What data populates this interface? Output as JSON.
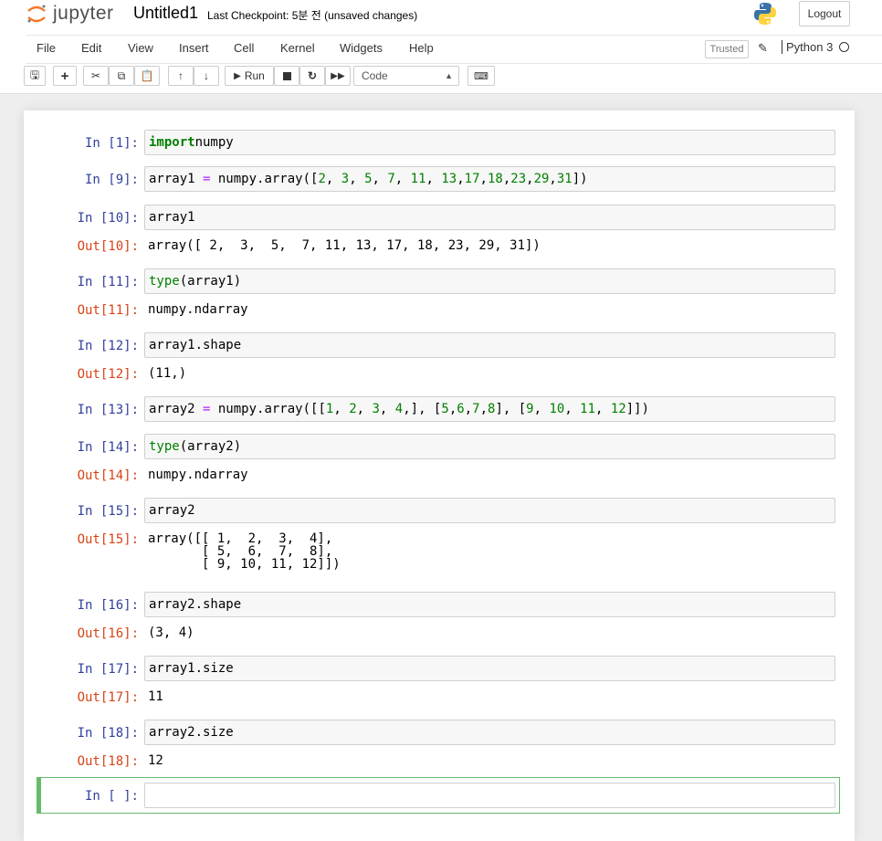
{
  "header": {
    "logo_text": "jupyter",
    "notebook_name": "Untitled1",
    "checkpoint": "Last Checkpoint: 5분 전  (unsaved changes)",
    "logout_label": "Logout"
  },
  "menu": {
    "items": [
      "File",
      "Edit",
      "View",
      "Insert",
      "Cell",
      "Kernel",
      "Widgets",
      "Help"
    ],
    "trusted_label": "Trusted",
    "kernel_name": "Python 3"
  },
  "toolbar": {
    "run_label": "Run",
    "cell_type": "Code"
  },
  "cells": [
    {
      "in": "In [1]:",
      "code": [
        [
          "kw",
          "import"
        ],
        [
          "",
          "numpy"
        ]
      ],
      "out": null,
      "out_text": null
    },
    {
      "in": "In [9]:",
      "code": [
        [
          "",
          "array1 "
        ],
        [
          "op",
          "="
        ],
        [
          "",
          " numpy.array(["
        ],
        [
          "num",
          "2"
        ],
        [
          "",
          ", "
        ],
        [
          "num",
          "3"
        ],
        [
          "",
          ", "
        ],
        [
          "num",
          "5"
        ],
        [
          "",
          ", "
        ],
        [
          "num",
          "7"
        ],
        [
          "",
          ", "
        ],
        [
          "num",
          "11"
        ],
        [
          "",
          ", "
        ],
        [
          "num",
          "13"
        ],
        [
          "",
          ","
        ],
        [
          "num",
          "17"
        ],
        [
          "",
          ","
        ],
        [
          "num",
          "18"
        ],
        [
          "",
          ","
        ],
        [
          "num",
          "23"
        ],
        [
          "",
          ","
        ],
        [
          "num",
          "29"
        ],
        [
          "",
          ","
        ],
        [
          "num",
          "31"
        ],
        [
          "",
          "])"
        ]
      ],
      "out": null,
      "out_text": null
    },
    {
      "in": "In [10]:",
      "code": [
        [
          "",
          "array1"
        ]
      ],
      "out": "Out[10]:",
      "out_text": "array([ 2,  3,  5,  7, 11, 13, 17, 18, 23, 29, 31])"
    },
    {
      "in": "In [11]:",
      "code": [
        [
          "bi",
          "type"
        ],
        [
          "",
          "(array1)"
        ]
      ],
      "out": "Out[11]:",
      "out_text": "numpy.ndarray"
    },
    {
      "in": "In [12]:",
      "code": [
        [
          "",
          "array1.shape"
        ]
      ],
      "out": "Out[12]:",
      "out_text": "(11,)"
    },
    {
      "in": "In [13]:",
      "code": [
        [
          "",
          "array2 "
        ],
        [
          "op",
          "="
        ],
        [
          "",
          " numpy.array([["
        ],
        [
          "num",
          "1"
        ],
        [
          "",
          ", "
        ],
        [
          "num",
          "2"
        ],
        [
          "",
          ", "
        ],
        [
          "num",
          "3"
        ],
        [
          "",
          ", "
        ],
        [
          "num",
          "4"
        ],
        [
          "",
          ",], ["
        ],
        [
          "num",
          "5"
        ],
        [
          "",
          ","
        ],
        [
          "num",
          "6"
        ],
        [
          "",
          ","
        ],
        [
          "num",
          "7"
        ],
        [
          "",
          ","
        ],
        [
          "num",
          "8"
        ],
        [
          "",
          "], ["
        ],
        [
          "num",
          "9"
        ],
        [
          "",
          ", "
        ],
        [
          "num",
          "10"
        ],
        [
          "",
          ", "
        ],
        [
          "num",
          "11"
        ],
        [
          "",
          ", "
        ],
        [
          "num",
          "12"
        ],
        [
          "",
          "]])"
        ]
      ],
      "out": null,
      "out_text": null
    },
    {
      "in": "In [14]:",
      "code": [
        [
          "bi",
          "type"
        ],
        [
          "",
          "(array2)"
        ]
      ],
      "out": "Out[14]:",
      "out_text": "numpy.ndarray"
    },
    {
      "in": "In [15]:",
      "code": [
        [
          "",
          "array2"
        ]
      ],
      "out": "Out[15]:",
      "out_text": "array([[ 1,  2,  3,  4],\n       [ 5,  6,  7,  8],\n       [ 9, 10, 11, 12]])"
    },
    {
      "in": "In [16]:",
      "code": [
        [
          "",
          "array2.shape"
        ]
      ],
      "out": "Out[16]:",
      "out_text": "(3, 4)"
    },
    {
      "in": "In [17]:",
      "code": [
        [
          "",
          "array1.size"
        ]
      ],
      "out": "Out[17]:",
      "out_text": "11"
    },
    {
      "in": "In [18]:",
      "code": [
        [
          "",
          "array2.size"
        ]
      ],
      "out": "Out[18]:",
      "out_text": "12"
    },
    {
      "in": "In [ ]:",
      "code": [],
      "out": null,
      "out_text": null
    }
  ]
}
